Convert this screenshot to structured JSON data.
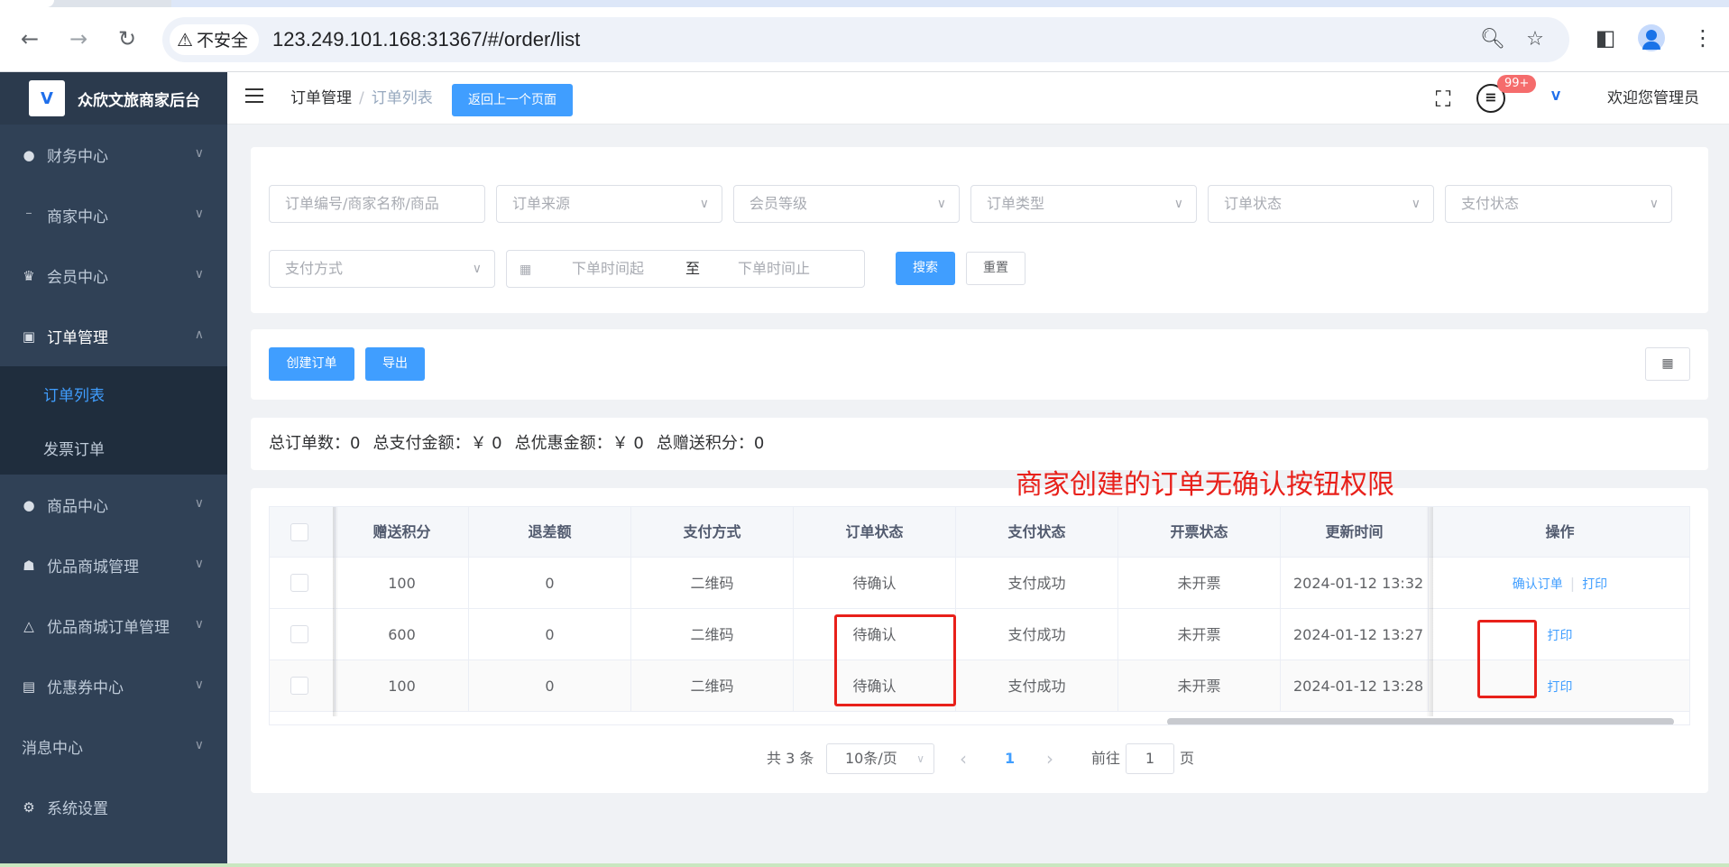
{
  "browser": {
    "security_label": "不安全",
    "url": "123.249.101.168:31367/#/order/list"
  },
  "sidebar": {
    "app_title": "众欣文旅商家后台",
    "items": [
      {
        "label": "财务中心",
        "icon": "money-bag-icon"
      },
      {
        "label": "商家中心",
        "icon": "merchant-icon"
      },
      {
        "label": "会员中心",
        "icon": "crown-icon"
      },
      {
        "label": "订单管理",
        "icon": "clipboard-icon"
      },
      {
        "label": "商品中心",
        "icon": "goods-icon"
      },
      {
        "label": "优品商城管理",
        "icon": "shop-icon"
      },
      {
        "label": "优品商城订单管理",
        "icon": "bell-icon"
      },
      {
        "label": "优惠券中心",
        "icon": "ticket-icon"
      },
      {
        "label": "消息中心",
        "icon": ""
      },
      {
        "label": "系统设置",
        "icon": "gear-icon"
      }
    ],
    "sub_items": [
      {
        "label": "订单列表"
      },
      {
        "label": "发票订单"
      }
    ]
  },
  "header": {
    "crumb_root": "订单管理",
    "crumb_sep": "/",
    "crumb_current": "订单列表",
    "back_label": "返回上一个页面",
    "badge": "99+",
    "welcome": "欢迎您管理员"
  },
  "filters": {
    "order_keyword_placeholder": "订单编号/商家名称/商品",
    "order_source": "订单来源",
    "member_level": "会员等级",
    "order_type": "订单类型",
    "order_status": "订单状态",
    "pay_status": "支付状态",
    "pay_method": "支付方式",
    "date_start": "下单时间起",
    "date_to": "至",
    "date_end": "下单时间止",
    "search_label": "搜索",
    "reset_label": "重置"
  },
  "toolbar": {
    "create_label": "创建订单",
    "export_label": "导出"
  },
  "summary": {
    "total_orders": "总订单数：0",
    "total_paid": "总支付金额：￥ 0",
    "total_discount": "总优惠金额：￥ 0",
    "total_points": "总赠送积分：0"
  },
  "annotation": "商家创建的订单无确认按钮权限",
  "table": {
    "columns": [
      "赠送积分",
      "退差额",
      "支付方式",
      "订单状态",
      "支付状态",
      "开票状态",
      "更新时间",
      "操作"
    ],
    "rows": [
      {
        "points": "100",
        "refund": "0",
        "pay_method": "二维码",
        "order_status": "待确认",
        "pay_status": "支付成功",
        "invoice_status": "未开票",
        "updated": "2024-01-12 13:32",
        "confirm": "确认订单",
        "print": "打印"
      },
      {
        "points": "600",
        "refund": "0",
        "pay_method": "二维码",
        "order_status": "待确认",
        "pay_status": "支付成功",
        "invoice_status": "未开票",
        "updated": "2024-01-12 13:27",
        "confirm": "",
        "print": "打印"
      },
      {
        "points": "100",
        "refund": "0",
        "pay_method": "二维码",
        "order_status": "待确认",
        "pay_status": "支付成功",
        "invoice_status": "未开票",
        "updated": "2024-01-12 13:28",
        "confirm": "",
        "print": "打印"
      }
    ]
  },
  "pagination": {
    "total": "共 3 条",
    "page_size": "10条/页",
    "prev": "‹",
    "current": "1",
    "next": "›",
    "goto_prefix": "前往",
    "goto_value": "1",
    "goto_suffix": "页"
  },
  "colors": {
    "primary": "#409eff",
    "sidebar": "#304156",
    "annotation_red": "#e8201a"
  }
}
